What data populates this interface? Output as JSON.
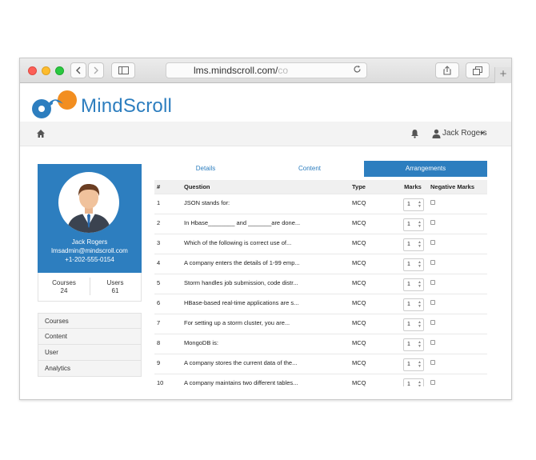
{
  "browser": {
    "url_main": "lms.mindscroll.com/",
    "url_faded": "co"
  },
  "brand": {
    "name": "MindScroll",
    "color": "#2d7ebf"
  },
  "nav": {
    "user_name": "Jack Rogers"
  },
  "profile": {
    "name": "Jack Rogers",
    "email": "lmsadmin@mindscroll.com",
    "phone": "+1-202-555-0154"
  },
  "stats": {
    "courses_label": "Courses",
    "courses_value": "24",
    "users_label": "Users",
    "users_value": "61"
  },
  "side_menu": [
    "Courses",
    "Content",
    "User",
    "Analytics"
  ],
  "tabs": [
    "Details",
    "Content",
    "Arrangements"
  ],
  "table": {
    "headers": [
      "#",
      "Question",
      "Type",
      "Marks",
      "Negative Marks"
    ],
    "rows": [
      {
        "num": "1",
        "question": "JSON stands for:",
        "type": "MCQ",
        "marks": "1"
      },
      {
        "num": "2",
        "question": "In Hbase________ and _______are done...",
        "type": "MCQ",
        "marks": "1"
      },
      {
        "num": "3",
        "question": "Which of the following is correct use of...",
        "type": "MCQ",
        "marks": "1"
      },
      {
        "num": "4",
        "question": "A company enters the details of 1-99 emp...",
        "type": "MCQ",
        "marks": "1"
      },
      {
        "num": "5",
        "question": "Storm handles job submission, code distr...",
        "type": "MCQ",
        "marks": "1"
      },
      {
        "num": "6",
        "question": "HBase-based real-time applications are s...",
        "type": "MCQ",
        "marks": "1"
      },
      {
        "num": "7",
        "question": "For setting up a storm cluster, you are...",
        "type": "MCQ",
        "marks": "1"
      },
      {
        "num": "8",
        "question": "MongoDB is:",
        "type": "MCQ",
        "marks": "1"
      },
      {
        "num": "9",
        "question": "A company stores the current data of the...",
        "type": "MCQ",
        "marks": "1"
      },
      {
        "num": "10",
        "question": "A company maintains two different tables...",
        "type": "MCQ",
        "marks": "1"
      }
    ]
  }
}
